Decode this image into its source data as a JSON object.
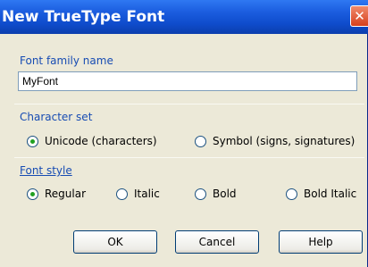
{
  "window": {
    "title": "New TrueType Font",
    "close_icon": "close-icon"
  },
  "font_family": {
    "label": "Font family name",
    "value": "MyFont"
  },
  "character_set": {
    "label": "Character set",
    "options": [
      {
        "label": "Unicode (characters)",
        "selected": true
      },
      {
        "label": "Symbol (signs, signatures)",
        "selected": false
      }
    ]
  },
  "font_style": {
    "label": "Font style",
    "options": [
      {
        "label": "Regular",
        "selected": true
      },
      {
        "label": "Italic",
        "selected": false
      },
      {
        "label": "Bold",
        "selected": false
      },
      {
        "label": "Bold Italic",
        "selected": false
      }
    ]
  },
  "buttons": {
    "ok": "OK",
    "cancel": "Cancel",
    "help": "Help"
  }
}
